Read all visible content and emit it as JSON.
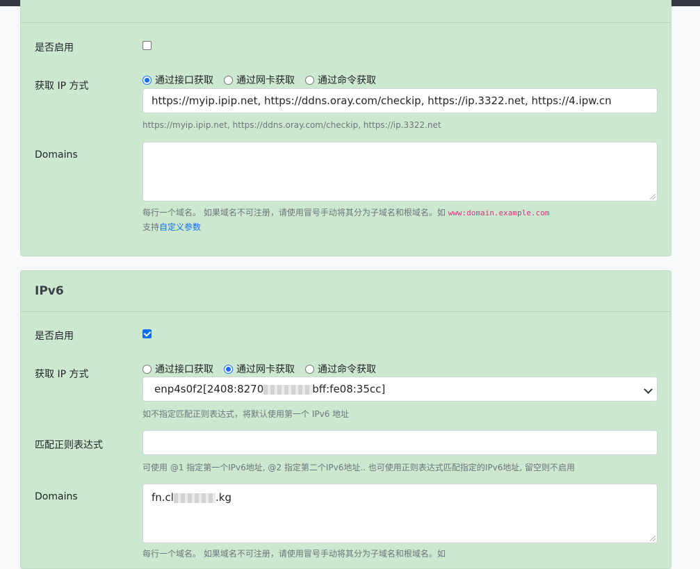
{
  "ipv4": {
    "enable_label": "是否启用",
    "enabled": false,
    "ip_method_label": "获取 IP 方式",
    "ip_methods": [
      "通过接口获取",
      "通过网卡获取",
      "通过命令获取"
    ],
    "selected_method": 0,
    "url_value": "https://myip.ipip.net, https://ddns.oray.com/checkip, https://ip.3322.net, https://4.ipw.cn",
    "url_help": "https://myip.ipip.net, https://ddns.oray.com/checkip, https://ip.3322.net",
    "domains_label": "Domains",
    "domains_value": "",
    "domains_help_text": "每行一个域名。 如果域名不可注册，请使用冒号手动将其分为子域名和根域名。如",
    "domains_help_code": "www:domain.example.com",
    "custom_prefix": "支持",
    "custom_link": "自定义参数"
  },
  "ipv6": {
    "title": "IPv6",
    "enable_label": "是否启用",
    "enabled": true,
    "ip_method_label": "获取 IP 方式",
    "ip_methods": [
      "通过接口获取",
      "通过网卡获取",
      "通过命令获取"
    ],
    "selected_method": 1,
    "nic_select_prefix": "enp4s0f2[2408:8270",
    "nic_select_suffix": "bff:fe08:35cc]",
    "nic_help": "如不指定匹配正则表达式，将默认使用第一个 IPv6 地址",
    "regex_label": "匹配正则表达式",
    "regex_value": "",
    "regex_help": "可使用 @1 指定第一个IPv6地址, @2 指定第二个IPv6地址.. 也可使用正则表达式匹配指定的IPv6地址, 留空则不启用",
    "domains_label": "Domains",
    "domains_prefix": "fn.cl",
    "domains_suffix": ".kg",
    "domains_help_text": "每行一个域名。 如果域名不可注册，请使用冒号手动将其分为子域名和根域名。如"
  }
}
